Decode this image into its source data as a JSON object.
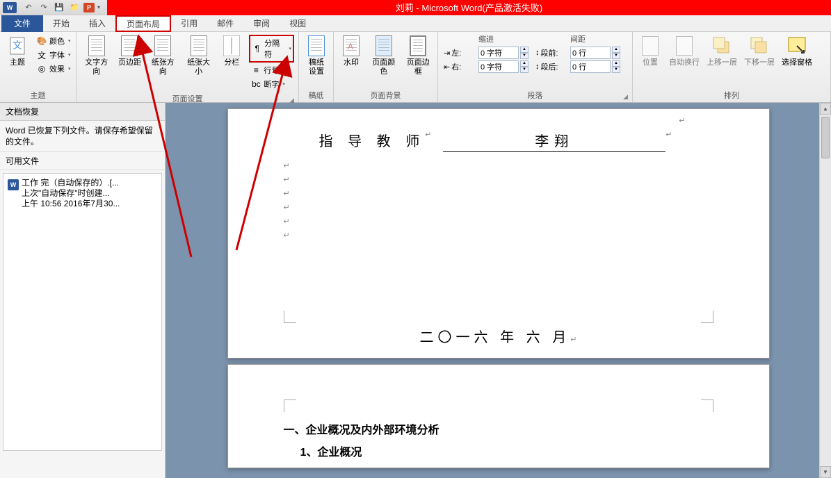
{
  "title_bar": {
    "app_icon": "W",
    "quick_access": {
      "undo": "↶",
      "redo": "↷",
      "save": "💾",
      "folder": "📁",
      "p": "P",
      "dropdown": "▾"
    },
    "title": "刘莉 - Microsoft Word(产品激活失败)"
  },
  "tabs": {
    "file": "文件",
    "items": [
      "开始",
      "插入",
      "页面布局",
      "引用",
      "邮件",
      "审阅",
      "视图"
    ],
    "active_index": 2
  },
  "ribbon": {
    "theme": {
      "label": "主题",
      "buttons": {
        "theme": "主题",
        "color": "颜色",
        "font": "字体",
        "effect": "效果"
      }
    },
    "page_setup": {
      "label": "页面设置",
      "buttons": {
        "text_dir": "文字方向",
        "margin": "页边距",
        "orientation": "纸张方向",
        "size": "纸张大小",
        "columns": "分栏",
        "breaks": "分隔符",
        "line_no": "行号",
        "hyphen": "断字"
      }
    },
    "paper": {
      "label": "稿纸",
      "button": "稿纸\n设置"
    },
    "bg": {
      "label": "页面背景",
      "watermark": "水印",
      "color": "页面颜色",
      "border": "页面边框"
    },
    "indent": {
      "label": "段落",
      "indent_header": "缩进",
      "spacing_header": "间距",
      "left": "左:",
      "right": "右:",
      "before": "段前:",
      "after": "段后:",
      "left_val": "0 字符",
      "right_val": "0 字符",
      "before_val": "0 行",
      "after_val": "0 行"
    },
    "arrange": {
      "label": "排列",
      "position": "位置",
      "wrap": "自动换行",
      "forward": "上移一层",
      "backward": "下移一层",
      "pane": "选择窗格"
    }
  },
  "recovery": {
    "title": "文档恢复",
    "message": "Word 已恢复下列文件。请保存希望保留的文件。",
    "available": "可用文件",
    "item": {
      "name": "工作 完（自动保存的）.[...",
      "line2": "上次\"自动保存\"时创建...",
      "line3": "上午 10:56 2016年7月30..."
    }
  },
  "document": {
    "teacher_label": "指 导 教 师",
    "teacher_name": "李翔",
    "date": "二〇一六 年 六 月",
    "page2_h1": "一、企业概况及内外部环境分析",
    "page2_h2": "1、企业概况"
  }
}
